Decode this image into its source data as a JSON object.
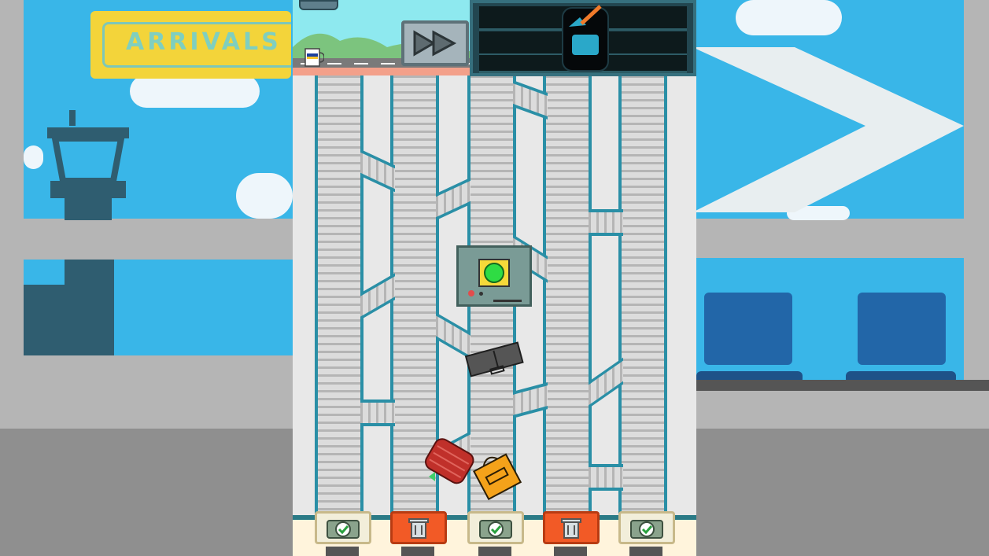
{
  "background": {
    "sign_text": "ARRIVALS",
    "sky_color": "#39b6e8",
    "wall_color": "#b5b5b5"
  },
  "hud": {
    "fast_forward_icon": "fast-forward-icon",
    "pause_icon": "pause-icon",
    "coffee_icon": "coffee-mug-icon"
  },
  "xray": {
    "item_icon": "knife-icon",
    "bag_icon": "backpack-icon"
  },
  "scanner": {
    "status_icon": "green-light-icon",
    "status_color": "#2fdc44"
  },
  "bins": [
    {
      "kind": "approve",
      "icon": "suitcase-check-icon"
    },
    {
      "kind": "trash",
      "icon": "trash-icon"
    },
    {
      "kind": "approve",
      "icon": "suitcase-check-icon"
    },
    {
      "kind": "trash",
      "icon": "trash-icon"
    },
    {
      "kind": "approve",
      "icon": "suitcase-check-icon"
    }
  ],
  "luggage": [
    {
      "type": "briefcase",
      "color": "#555555"
    },
    {
      "type": "red-duffel",
      "color": "#c0302a"
    },
    {
      "type": "orange-shopping-bag",
      "color": "#f4a21a"
    }
  ],
  "colors": {
    "belt_rail": "#2a8fa6",
    "trash_bin": "#f25a26",
    "accent_panel": "#224650"
  }
}
